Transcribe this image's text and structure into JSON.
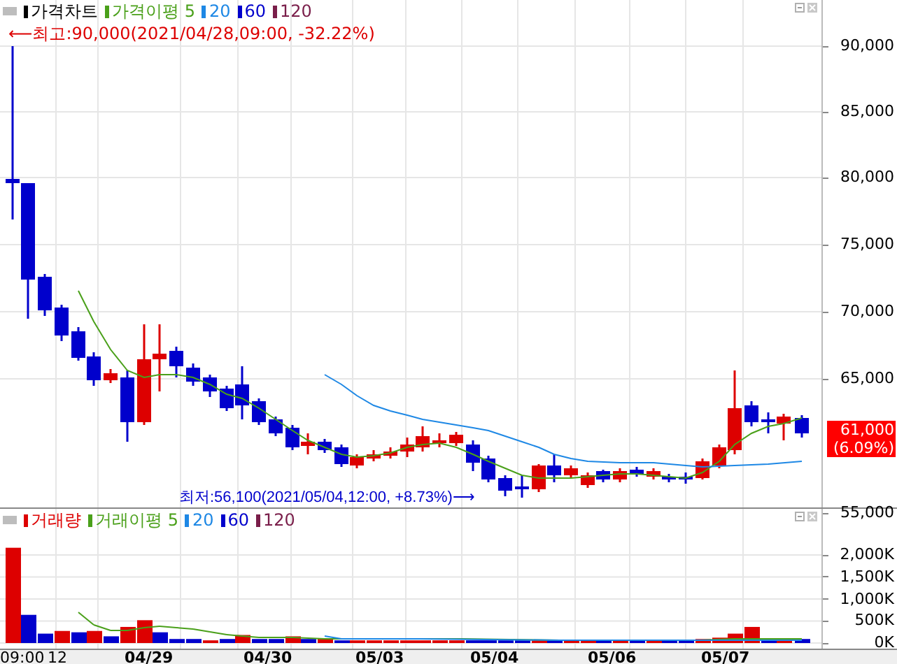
{
  "price_panel": {
    "legend": [
      {
        "label": "가격차트",
        "color": "#000000"
      },
      {
        "label": "가격이평 5",
        "color": "#4aa01a"
      },
      {
        "label": "20",
        "color": "#1e88e5"
      },
      {
        "label": "60",
        "color": "#0000cc"
      },
      {
        "label": "120",
        "color": "#7a1e4a"
      }
    ],
    "high_note": "⟵최고:90,000(2021/04/28,09:00, -32.22%)",
    "low_note": "최저:56,100(2021/05/04,12:00, +8.73%)⟶",
    "y_ticks": [
      "90,000",
      "85,000",
      "80,000",
      "75,000",
      "70,000",
      "65,000",
      "55,000"
    ],
    "current_price": "61,000",
    "current_change": "(6.09%)"
  },
  "volume_panel": {
    "legend": [
      {
        "label": "거래량",
        "color": "#dd0000"
      },
      {
        "label": "거래이평 5",
        "color": "#4aa01a"
      },
      {
        "label": "20",
        "color": "#1e88e5"
      },
      {
        "label": "60",
        "color": "#0000cc"
      },
      {
        "label": "120",
        "color": "#7a1e4a"
      }
    ],
    "y_ticks": [
      "2,000K",
      "1,500K",
      "1,000K",
      "500K",
      "0K"
    ]
  },
  "x_labels": [
    {
      "text": "09:00",
      "kind": "time"
    },
    {
      "text": "12",
      "kind": "time"
    },
    {
      "text": "04/29",
      "kind": "date"
    },
    {
      "text": "04/30",
      "kind": "date"
    },
    {
      "text": "05/03",
      "kind": "date"
    },
    {
      "text": "05/04",
      "kind": "date"
    },
    {
      "text": "05/06",
      "kind": "date"
    },
    {
      "text": "05/07",
      "kind": "date"
    }
  ]
}
